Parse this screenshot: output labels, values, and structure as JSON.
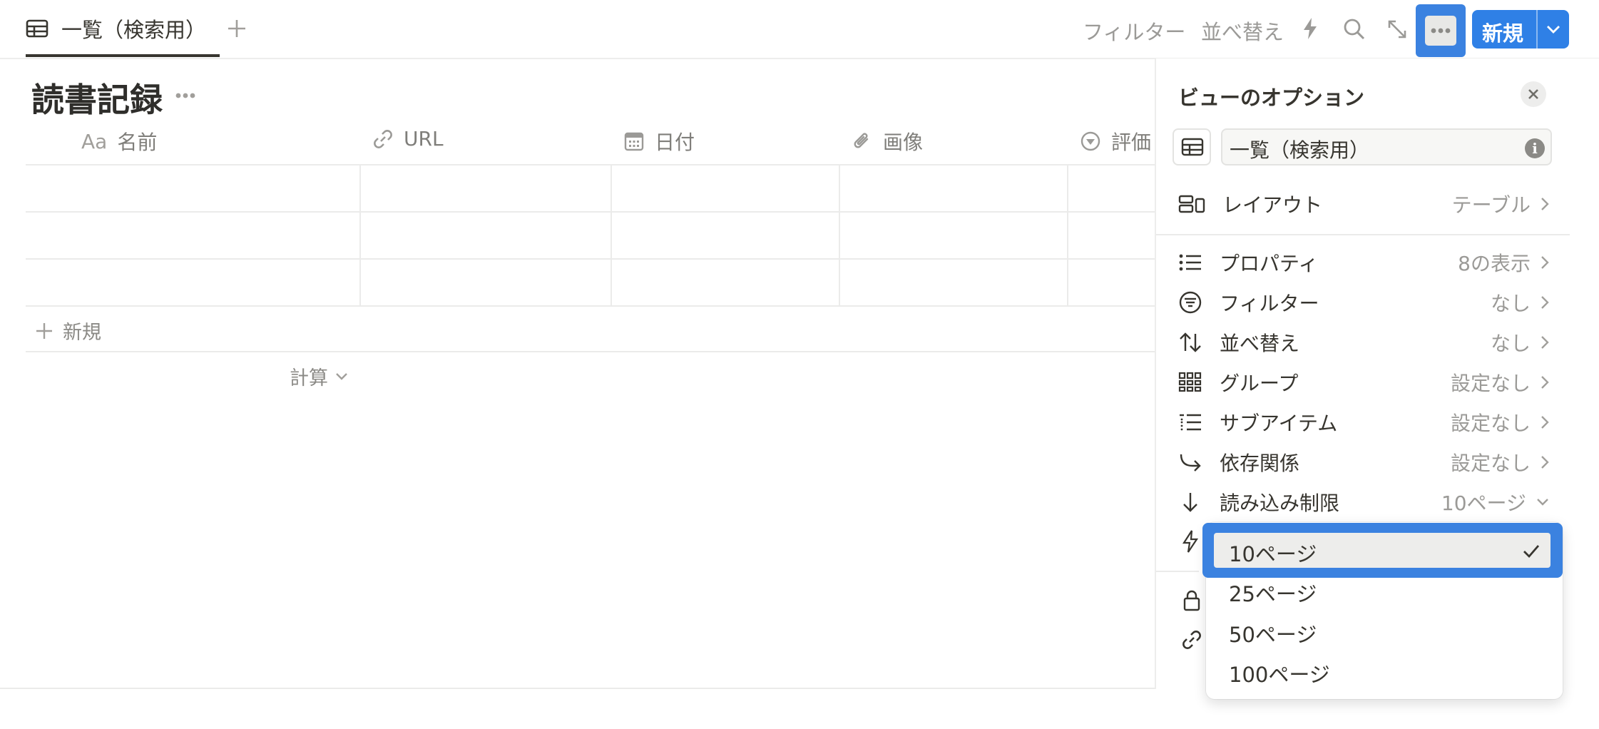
{
  "tabs": {
    "active_label": "一覧（検索用）",
    "add_label": "+"
  },
  "toolbar": {
    "filter_label": "フィルター",
    "sort_label": "並べ替え",
    "new_label": "新規"
  },
  "page": {
    "title": "読書記録",
    "more": "•••"
  },
  "table": {
    "columns": [
      {
        "label": "名前",
        "prefix": "Aa"
      },
      {
        "label": "URL"
      },
      {
        "label": "日付"
      },
      {
        "label": "画像"
      },
      {
        "label": "評価"
      }
    ],
    "new_row_label": "新規",
    "calc_label": "計算"
  },
  "panel": {
    "title": "ビューのオプション",
    "view_name": "一覧（検索用）",
    "rows": [
      {
        "label": "レイアウト",
        "value": "テーブル"
      },
      {
        "label": "プロパティ",
        "value": "8の表示"
      },
      {
        "label": "フィルター",
        "value": "なし"
      },
      {
        "label": "並べ替え",
        "value": "なし"
      },
      {
        "label": "グループ",
        "value": "設定なし"
      },
      {
        "label": "サブアイテム",
        "value": "設定なし"
      },
      {
        "label": "依存関係",
        "value": "設定なし"
      },
      {
        "label": "読み込み制限",
        "value": "10ページ"
      }
    ]
  },
  "dropdown": {
    "options": [
      "10ページ",
      "25ページ",
      "50ページ",
      "100ページ"
    ],
    "selected": "10ページ"
  },
  "colors": {
    "accent": "#2f80e6",
    "highlight": "#3b82e0"
  }
}
